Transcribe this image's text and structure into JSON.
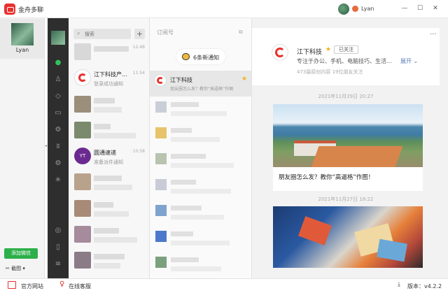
{
  "titlebar": {
    "app_name": "金舟多聊",
    "user_name": "Lyan",
    "min": "—",
    "max": "☐",
    "close": "✕"
  },
  "account": {
    "name": "Lyan",
    "add_wechat": "添加微信",
    "screenshot": "截图"
  },
  "search": {
    "placeholder": "搜索"
  },
  "chats": [
    {
      "name": "",
      "preview": "",
      "time": "12:48",
      "avatar": "#c8c8c8"
    },
    {
      "name": "江下科技产...",
      "preview": "登录成功通知",
      "time": "11:54",
      "avatar": "logo"
    },
    {
      "name": "",
      "preview": "",
      "time": "",
      "avatar": "#9b8f7b"
    },
    {
      "name": "",
      "preview": "",
      "time": "",
      "avatar": "#7b8a6d"
    },
    {
      "name": "圆通速递",
      "preview": "准备派件通知",
      "time": "10:58",
      "avatar": "#6b2a8f"
    },
    {
      "name": "",
      "preview": "",
      "time": "",
      "avatar": "#b9a28c"
    },
    {
      "name": "",
      "preview": "",
      "time": "",
      "avatar": "#a88a78"
    },
    {
      "name": "",
      "preview": "",
      "time": "",
      "avatar": "#a58b9b"
    },
    {
      "name": "",
      "preview": "",
      "time": "",
      "avatar": "#8a7b86"
    }
  ],
  "yto_logo": "YT",
  "subscriptions": {
    "header": "订阅号",
    "new_notice": "6条新通知",
    "selected": {
      "name": "江下科技",
      "preview": "朋友圈怎么发？教你“高逼格”作图"
    }
  },
  "detail": {
    "more": "···",
    "profile_name": "江下科技",
    "followed": "已关注",
    "description": "专注于办公、手机、电脑技巧、生活...",
    "expand": "展开",
    "stats": "473篇原创内容   19位朋友关注",
    "articles": [
      {
        "date": "2021年11月29日 20:27",
        "title": "朋友圈怎么发？教你“高逼格”作图！"
      },
      {
        "date": "2021年11月27日 18:22",
        "title": ""
      }
    ]
  },
  "bottom": {
    "site": "官方网站",
    "service": "在线客服",
    "version": "版本：v4.2.2"
  },
  "colors": {
    "accent": "#e8312f",
    "green": "#2daf4a",
    "star": "#f2b01e"
  }
}
